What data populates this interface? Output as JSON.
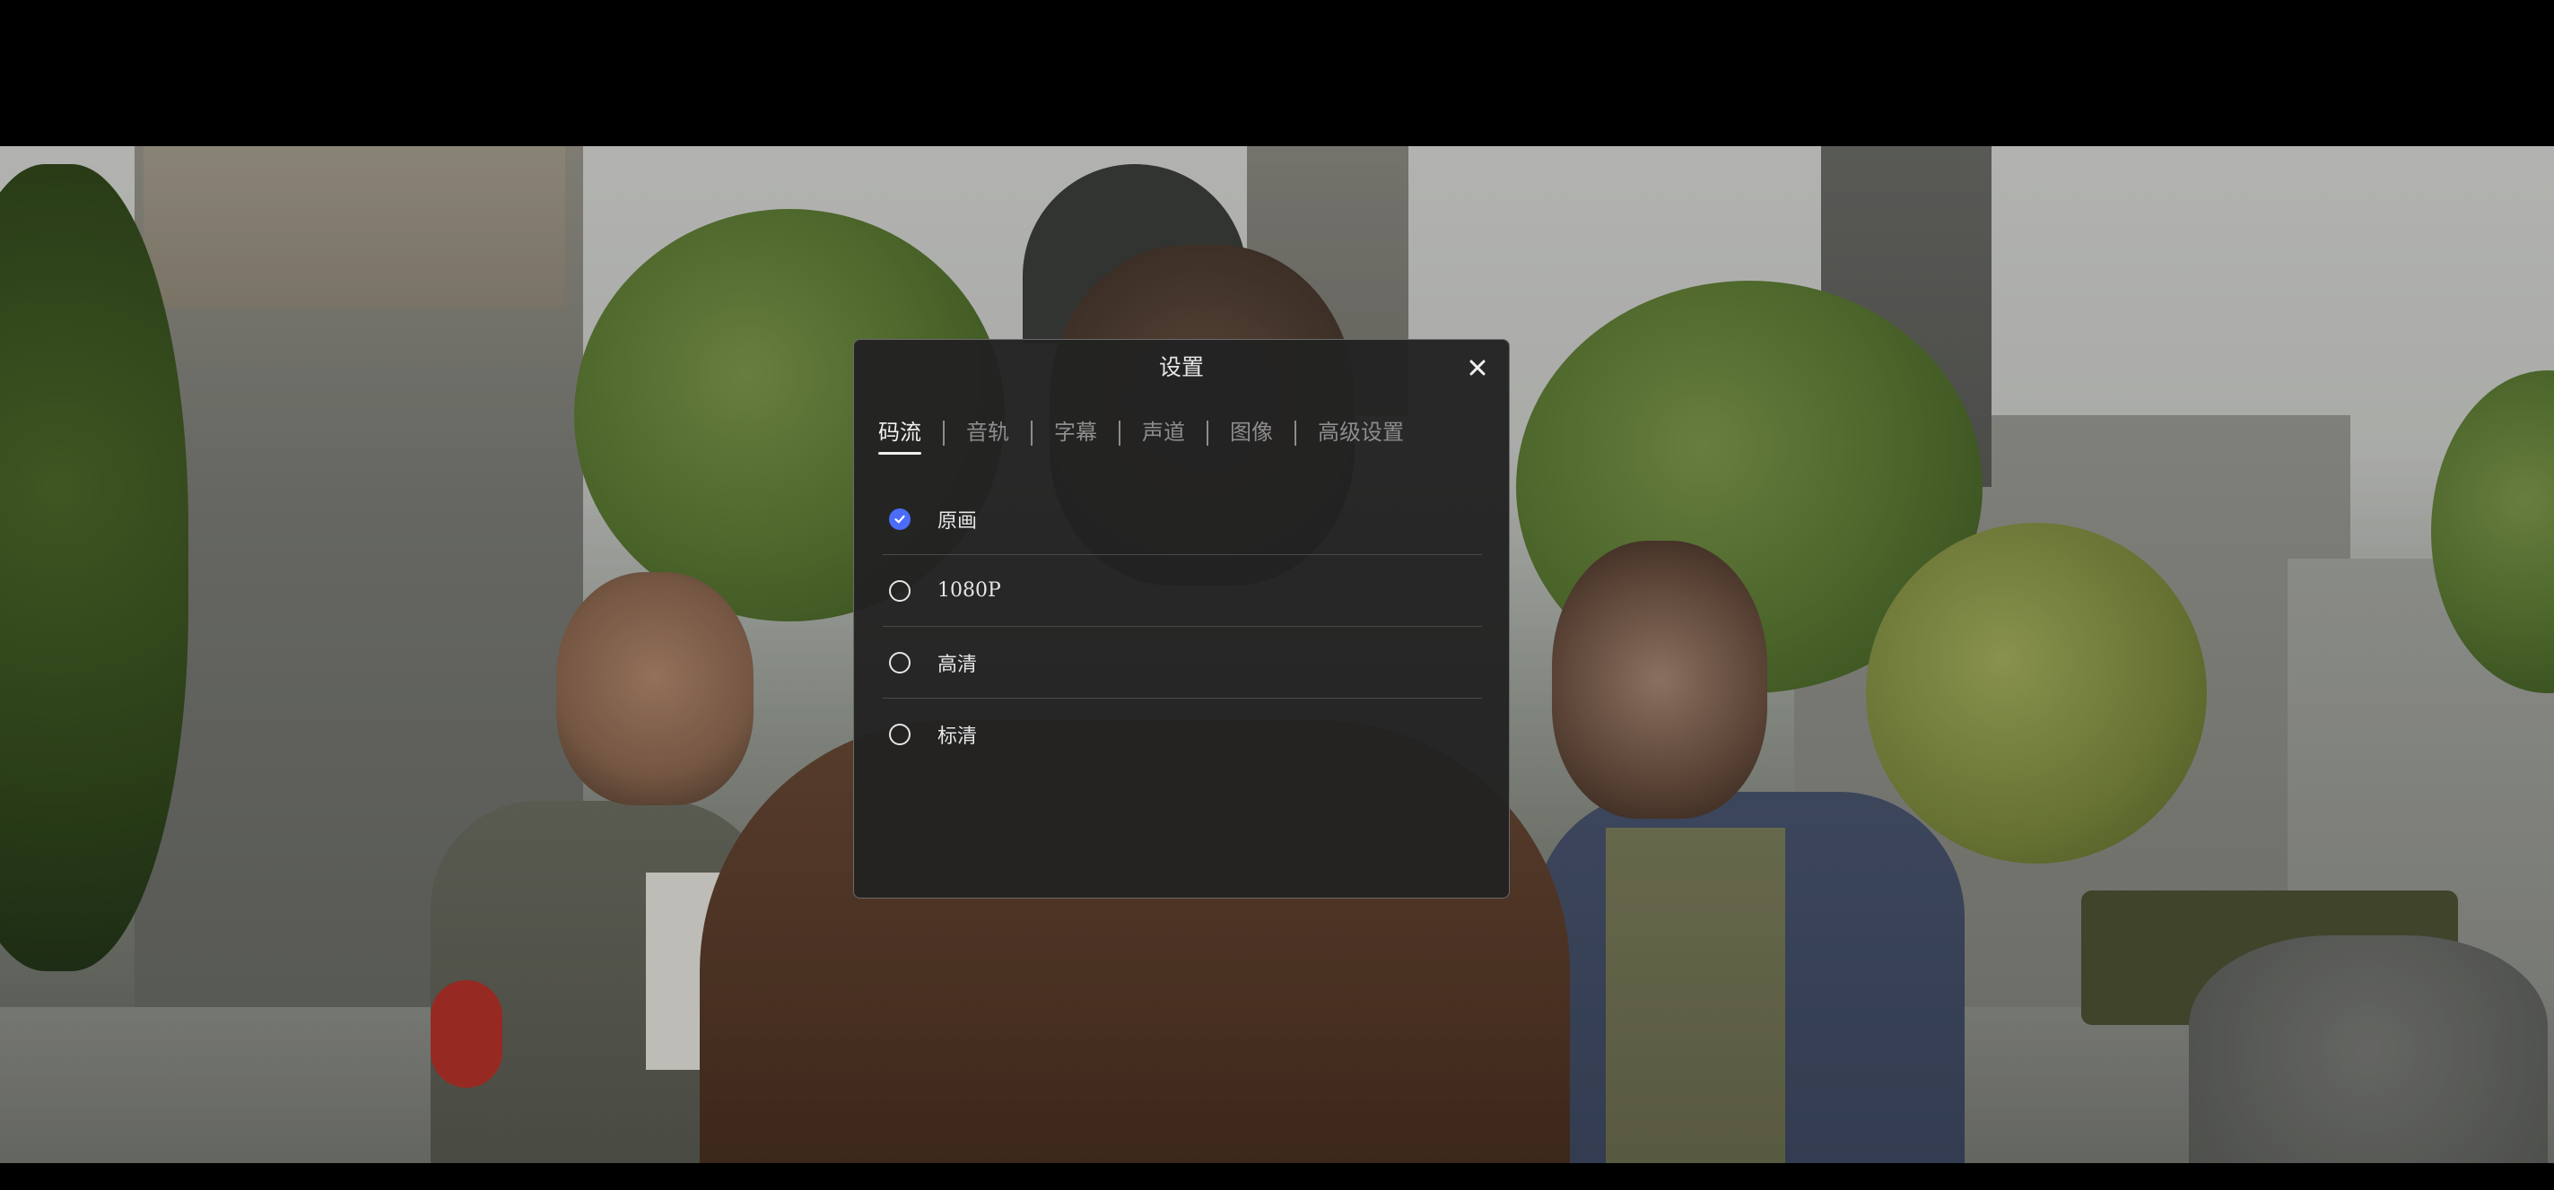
{
  "dialog": {
    "title": "设置",
    "close_icon": "close-icon",
    "tabs": [
      {
        "label": "码流",
        "active": true
      },
      {
        "label": "音轨",
        "active": false
      },
      {
        "label": "字幕",
        "active": false
      },
      {
        "label": "声道",
        "active": false
      },
      {
        "label": "图像",
        "active": false
      },
      {
        "label": "高级设置",
        "active": false
      }
    ],
    "options": [
      {
        "label": "原画",
        "selected": true
      },
      {
        "label": "1080P",
        "selected": false
      },
      {
        "label": "高清",
        "selected": false
      },
      {
        "label": "标清",
        "selected": false
      }
    ]
  },
  "colors": {
    "accent": "#4a6cf7",
    "dialog_background": "#222222",
    "letterbox": "#000000"
  }
}
